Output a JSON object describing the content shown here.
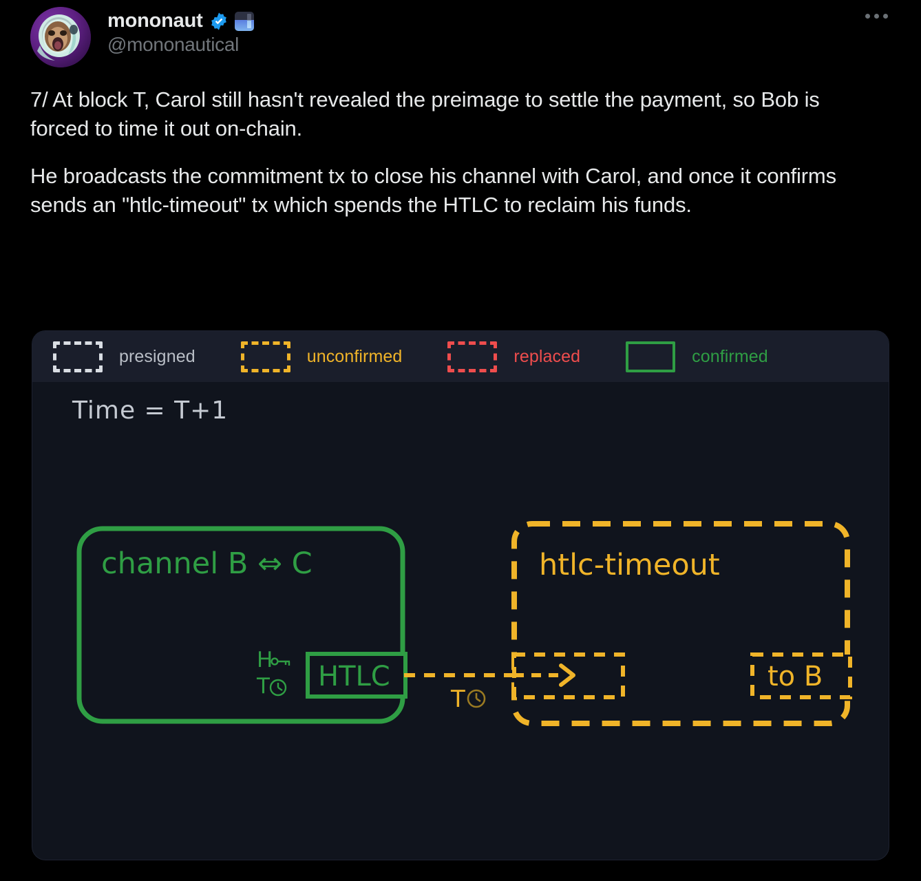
{
  "tweet": {
    "author": {
      "display_name": "mononaut",
      "handle": "@mononautical",
      "verified_badge": "verified-check-icon",
      "avatar": "astronaut-monkey-avatar",
      "emoji": "blue-square-emoji"
    },
    "more_menu": "more-options-icon",
    "paragraphs": [
      "7/ At block T, Carol still hasn't revealed the preimage to settle the payment, so Bob is forced to time it out on-chain.",
      "He broadcasts the commitment tx to close his channel with Carol, and once it confirms sends an \"htlc-timeout\" tx which spends the HTLC to reclaim his funds."
    ]
  },
  "diagram": {
    "legend": [
      {
        "label": "presigned",
        "color": "#b9bec6",
        "border": "#d9dde3",
        "style": "dashed"
      },
      {
        "label": "unconfirmed",
        "color": "#f0b429",
        "border": "#f0b429",
        "style": "dashed"
      },
      {
        "label": "replaced",
        "color": "#ef4d4d",
        "border": "#ef4d4d",
        "style": "dashed"
      },
      {
        "label": "confirmed",
        "color": "#2f9e44",
        "border": "#2f9e44",
        "style": "solid"
      }
    ],
    "time_label": "Time = T+1",
    "channel_box": {
      "title": "channel B ⇔ C",
      "state": "confirmed",
      "color": "#2f9e44",
      "output": {
        "label": "HTLC",
        "conditions": [
          "H",
          "T"
        ],
        "condition_icons": [
          "key-icon",
          "clock-icon"
        ]
      }
    },
    "spend_arrow": {
      "label": "T",
      "icon": "clock-icon",
      "color": "#f0b429"
    },
    "timeout_box": {
      "title": "htlc-timeout",
      "state": "unconfirmed",
      "color": "#f0b429",
      "input_label": "",
      "output": {
        "label": "to B"
      }
    }
  }
}
